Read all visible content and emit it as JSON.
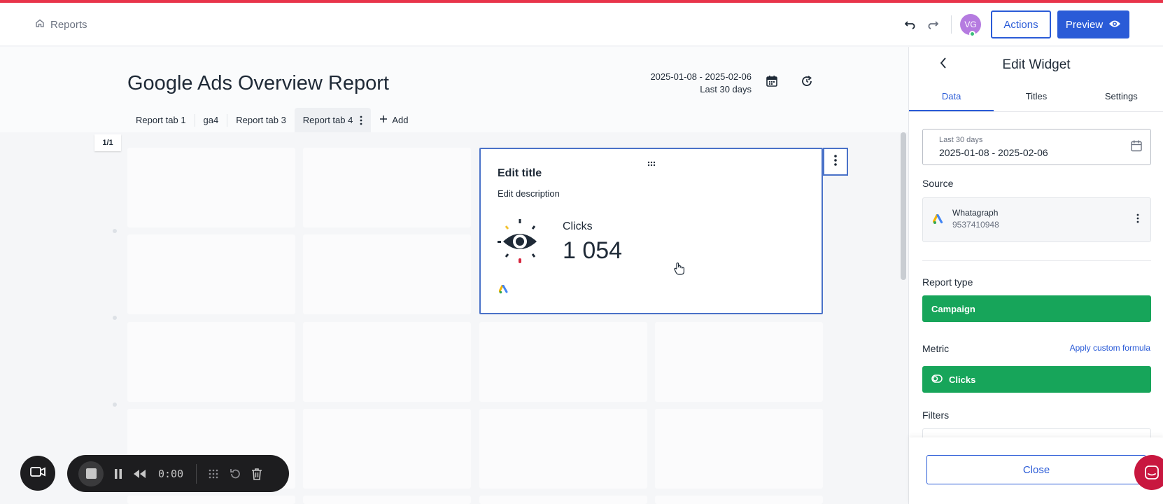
{
  "header": {
    "breadcrumb": "Reports",
    "avatar_initials": "VG",
    "actions_label": "Actions",
    "preview_label": "Preview"
  },
  "report": {
    "title": "Google Ads Overview Report",
    "date_range": "2025-01-08 - 2025-02-06",
    "date_preset": "Last 30 days",
    "tabs": [
      {
        "label": "Report tab 1"
      },
      {
        "label": "ga4"
      },
      {
        "label": "Report tab 3"
      },
      {
        "label": "Report tab 4"
      }
    ],
    "add_tab_label": "Add",
    "page_indicator": "1/1"
  },
  "widget": {
    "title": "Edit title",
    "description": "Edit description",
    "metric_label": "Clicks",
    "metric_value": "1 054"
  },
  "panel": {
    "title": "Edit Widget",
    "tabs": [
      {
        "label": "Data"
      },
      {
        "label": "Titles"
      },
      {
        "label": "Settings"
      }
    ],
    "date_field": {
      "label": "Last 30 days",
      "value": "2025-01-08 - 2025-02-06"
    },
    "source_label": "Source",
    "source": {
      "name": "Whatagraph",
      "id": "9537410948"
    },
    "report_type_label": "Report type",
    "report_type_value": "Campaign",
    "metric_label": "Metric",
    "custom_formula_label": "Apply custom formula",
    "metric_value": "Clicks",
    "filters_label": "Filters",
    "close_label": "Close"
  },
  "recorder": {
    "time": "0:00"
  },
  "colors": {
    "accent": "#2a5bd7",
    "top_line": "#e8344a",
    "green": "#17a55a",
    "chat": "#c8173f"
  }
}
